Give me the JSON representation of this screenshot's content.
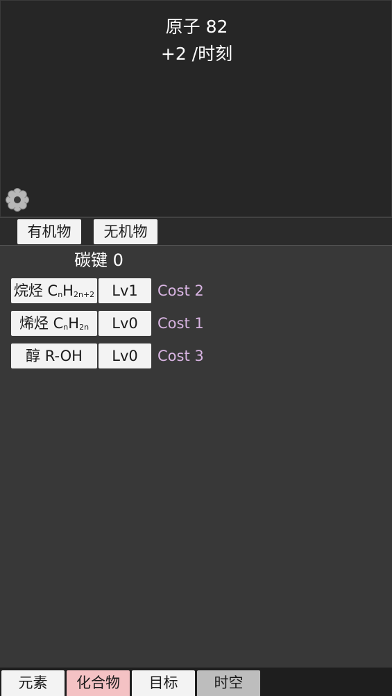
{
  "header": {
    "atoms_label": "原子",
    "atoms_value": "82",
    "rate_text": "+2 /时刻"
  },
  "settings_icon": "gear-icon",
  "category_tabs": [
    {
      "label": "有机物",
      "active": true
    },
    {
      "label": "无机物",
      "active": false
    }
  ],
  "bonds": {
    "label": "碳键",
    "value": "0"
  },
  "compounds": [
    {
      "name": "烷烃",
      "formula": [
        {
          "t": "C"
        },
        {
          "s": "n"
        },
        {
          "t": "H"
        },
        {
          "s": "2n+2"
        }
      ],
      "level": "Lv1",
      "cost": "Cost 2"
    },
    {
      "name": "烯烃",
      "formula": [
        {
          "t": "C"
        },
        {
          "s": "n"
        },
        {
          "t": "H"
        },
        {
          "s": "2n"
        }
      ],
      "level": "Lv0",
      "cost": "Cost 1"
    },
    {
      "name": "醇",
      "formula": [
        {
          "t": "R-OH"
        }
      ],
      "level": "Lv0",
      "cost": "Cost 3"
    }
  ],
  "bottom_tabs": [
    {
      "label": "元素",
      "color": "#f3f3f3"
    },
    {
      "label": "化合物",
      "color": "#f4c2c4"
    },
    {
      "label": "目标",
      "color": "#f3f3f3"
    },
    {
      "label": "时空",
      "color": "#bdbdbd"
    }
  ],
  "colors": {
    "cost_text": "#d8b4e2",
    "active_tab": "#f4c2c4",
    "locked_tab": "#bdbdbd"
  }
}
